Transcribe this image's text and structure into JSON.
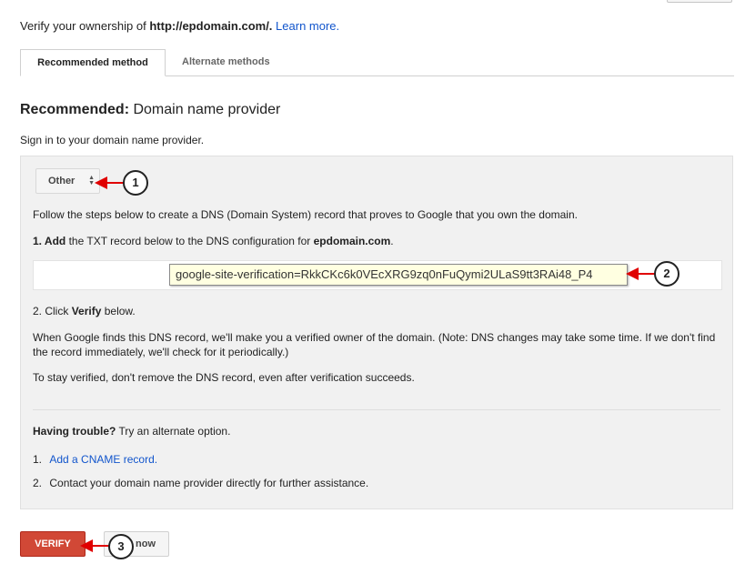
{
  "header": {
    "verify_prefix": "Verify your ownership of ",
    "domain_url": "http://epdomain.com/.",
    "learn_more": "Learn more."
  },
  "tabs": [
    {
      "label": "Recommended method",
      "active": true
    },
    {
      "label": "Alternate methods",
      "active": false
    }
  ],
  "section": {
    "heading_bold": "Recommended:",
    "heading_rest": " Domain name provider",
    "signin_text": "Sign in to your domain name provider."
  },
  "provider_select": {
    "selected": "Other"
  },
  "steps": {
    "intro": "Follow the steps below to create a DNS (Domain System) record that proves to Google that you own the domain.",
    "step1_bold": "1. Add",
    "step1_rest": " the TXT record below to the DNS configuration for ",
    "step1_domain": "epdomain.com",
    "step1_end": ".",
    "txt_record": "google-site-verification=RkkCKc6k0VEcXRG9zq0nFuQymi2ULaS9tt3RAi48_P4",
    "step2_prefix": "2. Click ",
    "step2_bold": "Verify",
    "step2_rest": " below.",
    "note": "When Google finds this DNS record, we'll make you a verified owner of the domain. (Note: DNS changes may take some time. If we don't find the record immediately, we'll check for it periodically.)",
    "stay_verified": "To stay verified, don't remove the DNS record, even after verification succeeds."
  },
  "trouble": {
    "bold": "Having trouble?",
    "rest": " Try an alternate option.",
    "options": [
      {
        "num": "1.",
        "text": "Add a CNAME record."
      },
      {
        "num": "2.",
        "text": "Contact your domain name provider directly for further assistance."
      }
    ]
  },
  "buttons": {
    "verify": "VERIFY",
    "later": "now"
  },
  "callouts": [
    "1",
    "2",
    "3"
  ],
  "colors": {
    "link": "#1155cc",
    "verify_button": "#d14836",
    "panel_bg": "#f1f1f1",
    "tooltip_bg": "#ffffe1",
    "callout_arrow": "#e00000"
  }
}
